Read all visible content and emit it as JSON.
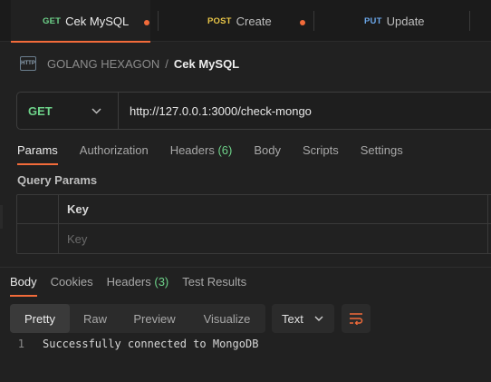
{
  "tabs": [
    {
      "method": "GET",
      "method_color": "#6ed38a",
      "name": "Cek MySQL",
      "active": true,
      "unsaved": true
    },
    {
      "method": "POST",
      "method_color": "#e8c547",
      "name": "Create",
      "active": false,
      "unsaved": true
    },
    {
      "method": "PUT",
      "method_color": "#6ba6e8",
      "name": "Update",
      "active": false,
      "unsaved": false
    }
  ],
  "breadcrumb": {
    "icon_text": "HTTP",
    "collection": "GOLANG HEXAGON",
    "separator": "/",
    "request": "Cek MySQL"
  },
  "request": {
    "method": "GET",
    "url": "http://127.0.0.1:3000/check-mongo"
  },
  "request_tabs": [
    {
      "label": "Params",
      "active": true
    },
    {
      "label": "Authorization"
    },
    {
      "label": "Headers",
      "count": "(6)"
    },
    {
      "label": "Body"
    },
    {
      "label": "Scripts"
    },
    {
      "label": "Settings"
    }
  ],
  "query_params": {
    "title": "Query Params",
    "header_key": "Key",
    "placeholder_key": "Key"
  },
  "response_tabs": [
    {
      "label": "Body",
      "active": true
    },
    {
      "label": "Cookies"
    },
    {
      "label": "Headers",
      "count": "(3)"
    },
    {
      "label": "Test Results"
    }
  ],
  "view_modes": [
    "Pretty",
    "Raw",
    "Preview",
    "Visualize"
  ],
  "active_view": "Pretty",
  "format": "Text",
  "response_body": {
    "line": "1",
    "text": "Successfully connected to MongoDB"
  },
  "colors": {
    "accent": "#f26b3a",
    "get": "#6ed38a",
    "post": "#e8c547",
    "put": "#6ba6e8"
  }
}
